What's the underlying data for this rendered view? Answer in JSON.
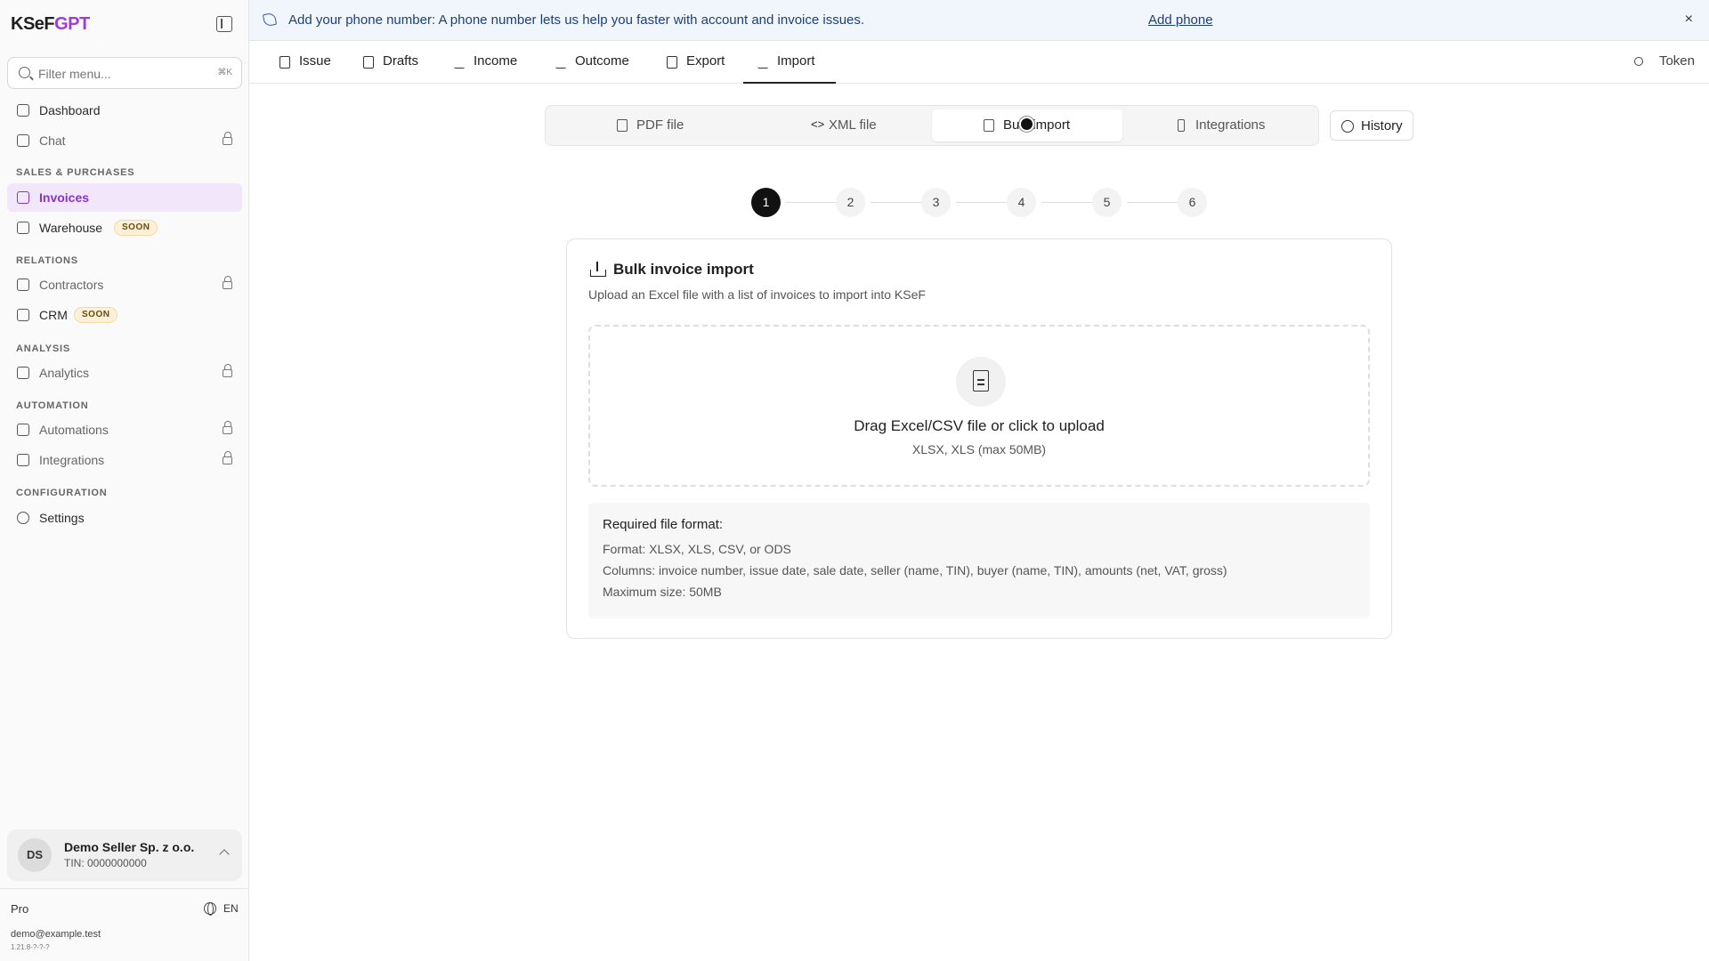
{
  "app": {
    "logo_part1": "KSeF",
    "logo_part2": "GPT"
  },
  "sidebar": {
    "filter_placeholder": "Filter menu...",
    "filter_shortcut": "⌘K",
    "items": {
      "dashboard": "Dashboard",
      "chat": "Chat",
      "invoices": "Invoices",
      "warehouse": "Warehouse",
      "contractors": "Contractors",
      "crm": "CRM",
      "analytics": "Analytics",
      "automations": "Automations",
      "integrations": "Integrations",
      "settings": "Settings"
    },
    "soon_badge": "SOON",
    "sections": {
      "sales": "SALES & PURCHASES",
      "relations": "RELATIONS",
      "analysis": "ANALYSIS",
      "automation": "AUTOMATION",
      "configuration": "CONFIGURATION"
    },
    "account": {
      "initials": "DS",
      "name": "Demo Seller Sp. z o.o.",
      "tin": "TIN: 0000000000"
    },
    "plan": "Pro",
    "language": "EN",
    "email": "demo@example.test",
    "version": "1.21.8-?-?-?"
  },
  "banner": {
    "text": "Add your phone number: A phone number lets us help you faster with account and invoice issues.",
    "link": "Add phone",
    "close": "×"
  },
  "tabs": [
    "Issue",
    "Drafts",
    "Income",
    "Outcome",
    "Export",
    "Import"
  ],
  "active_tab": "Import",
  "token_label": "Token",
  "segments": [
    "PDF file",
    "XML file",
    "Bulk import",
    "Integrations"
  ],
  "active_segment": "Bulk import",
  "history_label": "History",
  "steps": [
    "1",
    "2",
    "3",
    "4",
    "5",
    "6"
  ],
  "current_step": "1",
  "card": {
    "title": "Bulk invoice import",
    "subtitle": "Upload an Excel file with a list of invoices to import into KSeF",
    "dropzone_title": "Drag Excel/CSV file or click to upload",
    "dropzone_sub": "XLSX, XLS (max 50MB)",
    "format_title": "Required file format:",
    "format_lines": [
      "Format: XLSX, XLS, CSV, or ODS",
      "Columns: invoice number, issue date, sale date, seller (name, TIN), buyer (name, TIN), amounts (net, VAT, gross)",
      "Maximum size: 50MB"
    ]
  },
  "colors": {
    "accent": "#8a33c7",
    "banner_bg": "#f0f6fc",
    "soon_bg": "#fdf0d8"
  }
}
